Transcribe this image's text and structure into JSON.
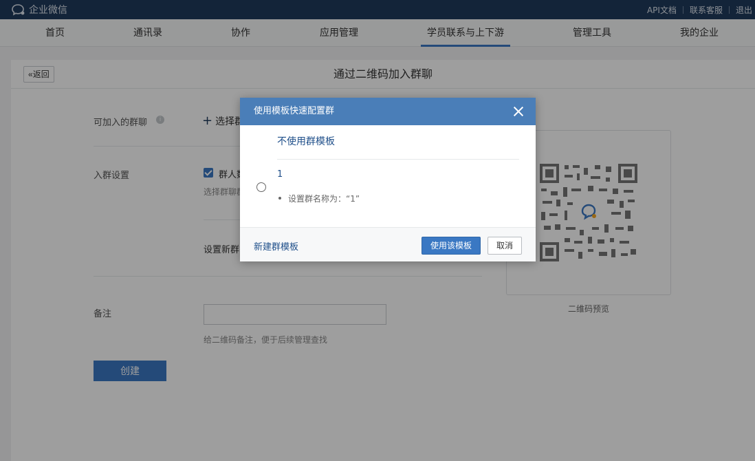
{
  "topbar": {
    "logo_text": "企业微信",
    "links": [
      "API文档",
      "联系客服",
      "退出"
    ]
  },
  "nav": {
    "items": [
      "首页",
      "通讯录",
      "协作",
      "应用管理",
      "学员联系与上下游",
      "管理工具",
      "我的企业"
    ],
    "active": "学员联系与上下游"
  },
  "page": {
    "back_label": "返回",
    "title": "通过二维码加入群聊",
    "group_label": "可加入的群聊",
    "select_group_label": "选择群",
    "join_settings_label": "入群设置",
    "join_checkbox_label": "群人数",
    "join_hint": "选择群聊群",
    "new_group_label": "设置新群",
    "note_label": "备注",
    "note_value": "",
    "note_hint": "给二维码备注，便于后续管理查找",
    "create_label": "创建",
    "qr_caption": "二维码预览"
  },
  "dialog": {
    "title": "使用模板快速配置群",
    "no_template": "不使用群模板",
    "template_name": "1",
    "template_detail": "设置群名称为：“1”",
    "new_template": "新建群模板",
    "use_button": "使用该模板",
    "cancel_button": "取消"
  },
  "colors": {
    "topbar": "#1f3a5c",
    "accent": "#3a78c3",
    "dialog_header": "#4a7eb8"
  }
}
